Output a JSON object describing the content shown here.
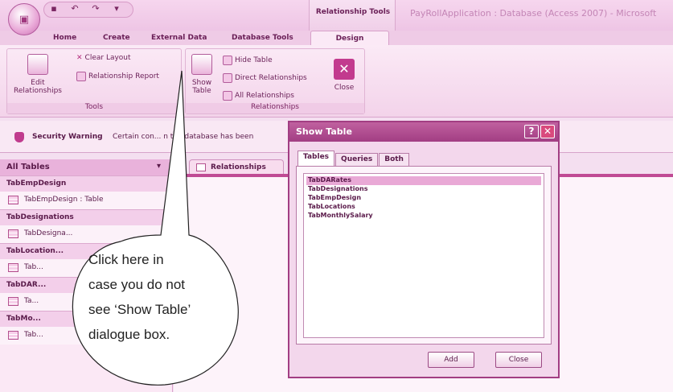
{
  "title_bar": {
    "context_tools": "Relationship Tools",
    "app_title": "PayRollApplication : Database (Access 2007) - Microsoft"
  },
  "tabs": [
    "Home",
    "Create",
    "External Data",
    "Database Tools",
    "Design"
  ],
  "ribbon": {
    "tools_group": {
      "label": "Tools",
      "edit_relationships": "Edit Relationships",
      "clear_layout": "Clear Layout",
      "relationship_report": "Relationship Report"
    },
    "relationships_group": {
      "label": "Relationships",
      "show_table": "Show Table",
      "hide_table": "Hide Table",
      "direct_relationships": "Direct Relationships",
      "all_relationships": "All Relationships",
      "close": "Close"
    }
  },
  "security": {
    "label": "Security Warning",
    "text": "Certain con... n the database has been"
  },
  "nav": {
    "header": "All Tables",
    "groups": [
      {
        "name": "TabEmpDesign",
        "item": "TabEmpDesign : Table"
      },
      {
        "name": "TabDesignations",
        "item": "TabDesigna..."
      },
      {
        "name": "TabLocation...",
        "item": "Tab..."
      },
      {
        "name": "TabDAR...",
        "item": "Ta..."
      },
      {
        "name": "TabMo...",
        "item": "Tab..."
      }
    ]
  },
  "doc_tab": "Relationships",
  "dialog": {
    "title": "Show Table",
    "tabs": [
      "Tables",
      "Queries",
      "Both"
    ],
    "items": [
      "TabDARates",
      "TabDesignations",
      "TabEmpDesign",
      "TabLocations",
      "TabMonthlySalary"
    ],
    "add": "Add",
    "close": "Close"
  },
  "callout": {
    "lines": [
      "Click here in",
      "case you do not",
      "see ‘Show Table’",
      "dialogue box."
    ]
  }
}
